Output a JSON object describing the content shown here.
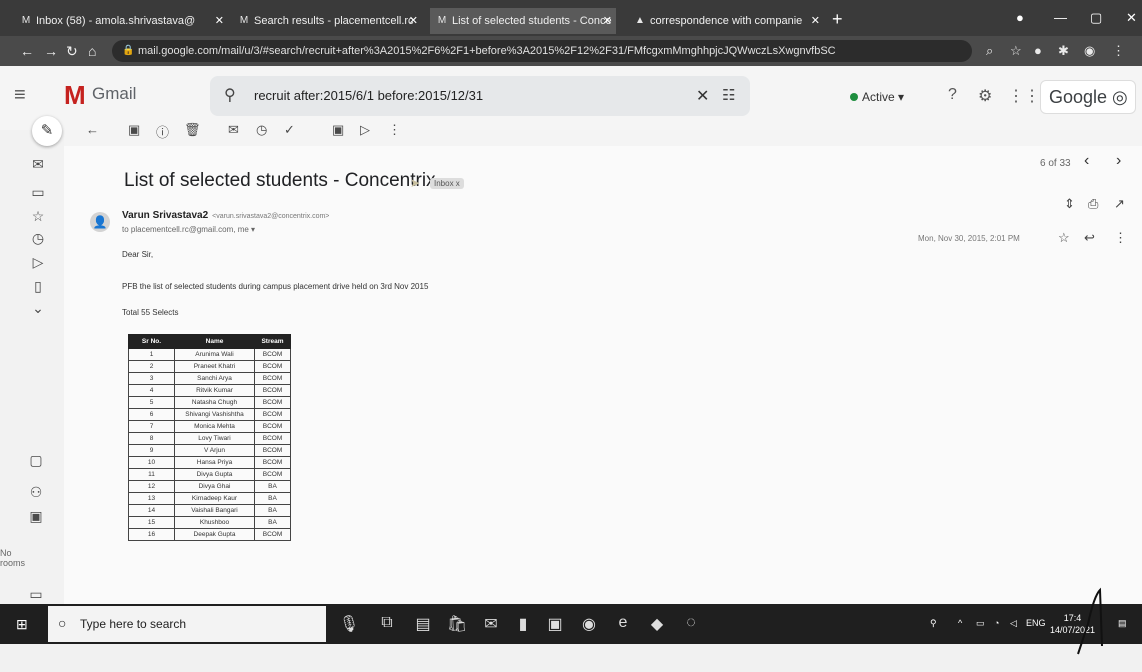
{
  "browser": {
    "tabs": [
      {
        "label": "Inbox (58) - amola.shrivastava@",
        "icon": "gmail-icon"
      },
      {
        "label": "Search results - placementcell.rc",
        "icon": "gmail-icon"
      },
      {
        "label": "List of selected students - Conce",
        "icon": "gmail-icon"
      },
      {
        "label": "correspondence with companie",
        "icon": "drive-icon"
      }
    ],
    "url": "mail.google.com/mail/u/3/#search/recruit+after%3A2015%2F6%2F1+before%3A2015%2F12%2F31/FMfcgxmMmghhpjcJQWwczLsXwgnvfbSC"
  },
  "gmail": {
    "brand": "Gmail",
    "search_query": "recruit after:2015/6/1 before:2015/12/31",
    "status": "Active",
    "account_badge": "Google",
    "pager": "6 of 33"
  },
  "rail": {
    "label_no_rooms": "No\nrooms"
  },
  "email": {
    "subject": "List of selected students - Concentrix",
    "label": "Inbox x",
    "sender_name": "Varun Srivastava2",
    "sender_email": "<varun.srivastava2@concentrix.com>",
    "to": "to placementcell.rc@gmail.com, me",
    "datetime": "Mon, Nov 30, 2015, 2:01 PM",
    "greeting": "Dear Sir,",
    "body": "PFB the list of selected students during campus placement drive held on 3rd Nov 2015",
    "total": "Total 55 Selects",
    "table": {
      "headers": [
        "Sr No.",
        "Name",
        "Stream"
      ],
      "rows": [
        [
          "1",
          "Arunima Wali",
          "BCOM"
        ],
        [
          "2",
          "Praneet Khatri",
          "BCOM"
        ],
        [
          "3",
          "Sanchi Arya",
          "BCOM"
        ],
        [
          "4",
          "Ritvik Kumar",
          "BCOM"
        ],
        [
          "5",
          "Natasha Chugh",
          "BCOM"
        ],
        [
          "6",
          "Shivangi Vashishtha",
          "BCOM"
        ],
        [
          "7",
          "Monica Mehta",
          "BCOM"
        ],
        [
          "8",
          "Lovy Tiwari",
          "BCOM"
        ],
        [
          "9",
          "V Arjun",
          "BCOM"
        ],
        [
          "10",
          "Hansa Priya",
          "BCOM"
        ],
        [
          "11",
          "Divya Gupta",
          "BCOM"
        ],
        [
          "12",
          "Divya Ghai",
          "BA"
        ],
        [
          "13",
          "Kirnadeep Kaur",
          "BA"
        ],
        [
          "14",
          "Vaishali Bangari",
          "BA"
        ],
        [
          "15",
          "Khushboo",
          "BA"
        ],
        [
          "16",
          "Deepak Gupta",
          "BCOM"
        ]
      ]
    }
  },
  "taskbar": {
    "search_placeholder": "Type here to search",
    "lang": "ENG",
    "time": "17:4",
    "date": "14/07/2021"
  }
}
